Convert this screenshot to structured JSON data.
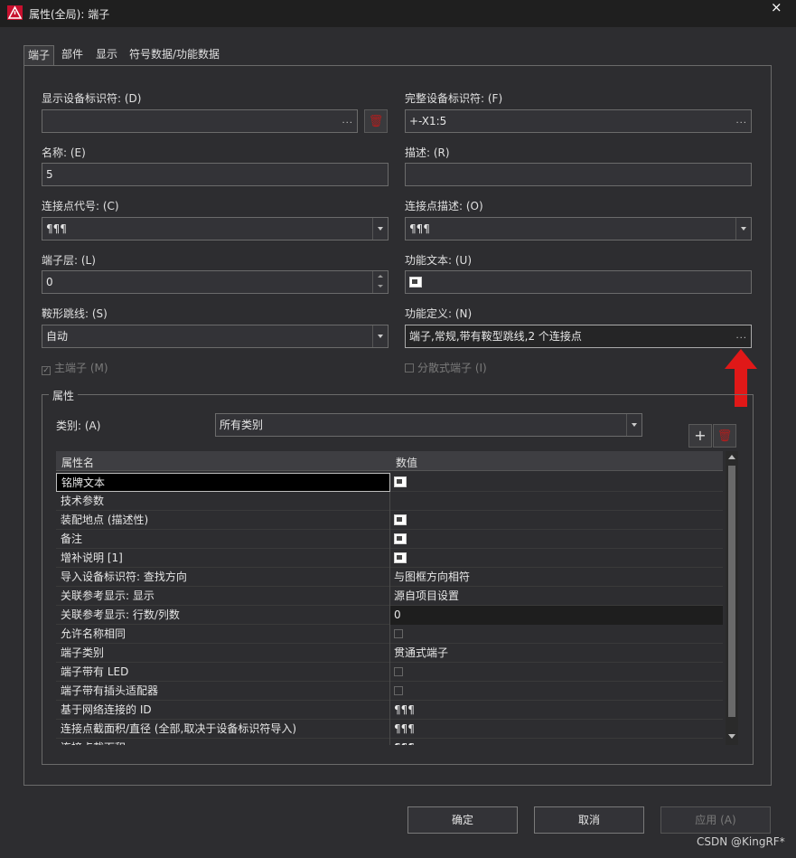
{
  "window": {
    "title": "属性(全局): 端子",
    "close_label": "×"
  },
  "tabs": [
    {
      "label": "端子",
      "active": true
    },
    {
      "label": "部件"
    },
    {
      "label": "显示"
    },
    {
      "label": "符号数据/功能数据"
    }
  ],
  "fields": {
    "display_dt": {
      "label": "显示设备标识符: (D)",
      "value": ""
    },
    "full_dt": {
      "label": "完整设备标识符: (F)",
      "value": "+-X1:5"
    },
    "name": {
      "label": "名称: (E)",
      "value": "5"
    },
    "description": {
      "label": "描述: (R)",
      "value": ""
    },
    "conn_code": {
      "label": "连接点代号: (C)",
      "value": "¶¶¶"
    },
    "conn_desc": {
      "label": "连接点描述: (O)",
      "value": "¶¶¶"
    },
    "terminal_level": {
      "label": "端子层: (L)",
      "value": "0"
    },
    "func_text": {
      "label": "功能文本: (U)",
      "value": ""
    },
    "saddle_jumper": {
      "label": "鞍形跳线: (S)",
      "value": "自动"
    },
    "func_def": {
      "label": "功能定义: (N)",
      "value": "端子,常规,带有鞍型跳线,2 个连接点"
    }
  },
  "checkboxes": {
    "main_terminal": {
      "label": "主端子 (M)",
      "checked": true
    },
    "distributed": {
      "label": "分散式端子 (I)",
      "checked": false
    }
  },
  "properties": {
    "group_title": "属性",
    "category_label": "类别: (A)",
    "category_value": "所有类别",
    "col_name": "属性名",
    "col_value": "数值",
    "rows": [
      {
        "name": "铭牌文本",
        "value": "",
        "type": "icon"
      },
      {
        "name": "技术参数",
        "value": "",
        "type": "text"
      },
      {
        "name": "装配地点 (描述性)",
        "value": "",
        "type": "icon"
      },
      {
        "name": "备注",
        "value": "",
        "type": "icon"
      },
      {
        "name": "增补说明 [1]",
        "value": "",
        "type": "icon"
      },
      {
        "name": "导入设备标识符: 查找方向",
        "value": "与图框方向相符",
        "type": "text"
      },
      {
        "name": "关联参考显示: 显示",
        "value": "源自项目设置",
        "type": "text"
      },
      {
        "name": "关联参考显示: 行数/列数",
        "value": "0",
        "type": "text"
      },
      {
        "name": "允许名称相同",
        "value": "",
        "type": "checkbox"
      },
      {
        "name": "端子类别",
        "value": "贯通式端子",
        "type": "text"
      },
      {
        "name": "端子带有 LED",
        "value": "",
        "type": "checkbox"
      },
      {
        "name": "端子带有插头适配器",
        "value": "",
        "type": "checkbox"
      },
      {
        "name": "基于网络连接的 ID",
        "value": "¶¶¶",
        "type": "text"
      },
      {
        "name": "连接点截面积/直径 (全部,取决于设备标识符导入)",
        "value": "¶¶¶",
        "type": "text"
      },
      {
        "name": "连接点截面积",
        "value": "¶¶¶",
        "type": "text"
      }
    ]
  },
  "buttons": {
    "ok": "确定",
    "cancel": "取消",
    "apply": "应用 (A)"
  },
  "watermark": "CSDN @KingRF*",
  "colors": {
    "accent_red": "#e01818",
    "background": "#2d2d30"
  }
}
